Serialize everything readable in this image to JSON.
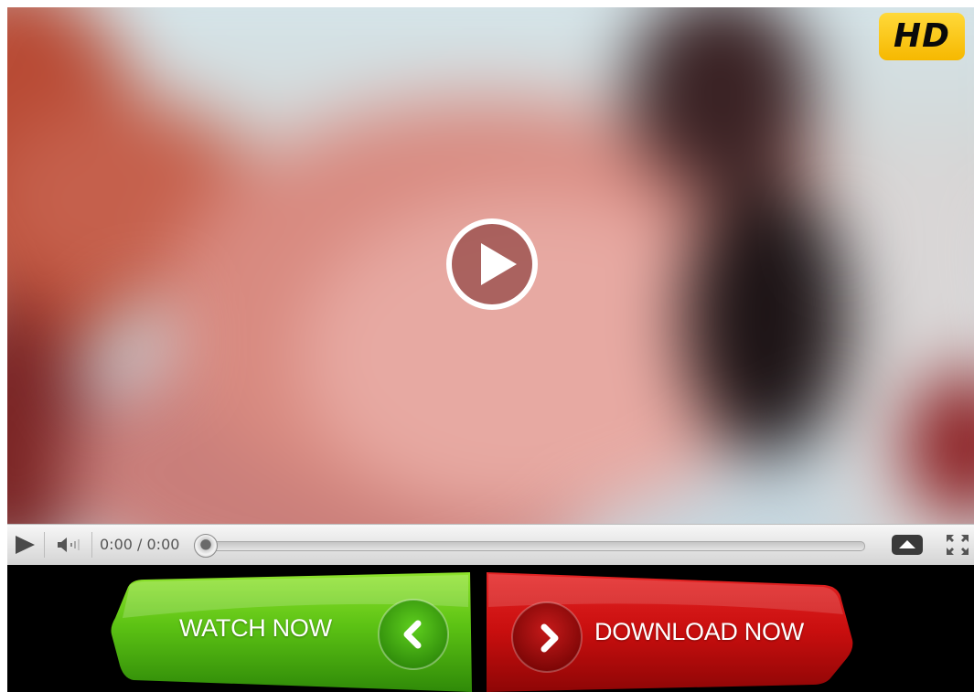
{
  "player": {
    "hd_badge": "HD",
    "time_display": "0:00 / 0:00",
    "progress": 0
  },
  "cta": {
    "watch_label": "WATCH NOW",
    "download_label": "DOWNLOAD NOW"
  },
  "colors": {
    "hd_badge": "#f9c400",
    "watch_button": "#5fbf1a",
    "download_button": "#cc1010",
    "background": "#000000"
  },
  "icons": {
    "big_play": "play-circle-icon",
    "watch_chevron": "chevron-left-icon",
    "download_chevron": "chevron-right-icon",
    "control_play": "play-icon",
    "volume": "volume-icon",
    "eject": "eject-icon",
    "fullscreen": "fullscreen-icon"
  }
}
